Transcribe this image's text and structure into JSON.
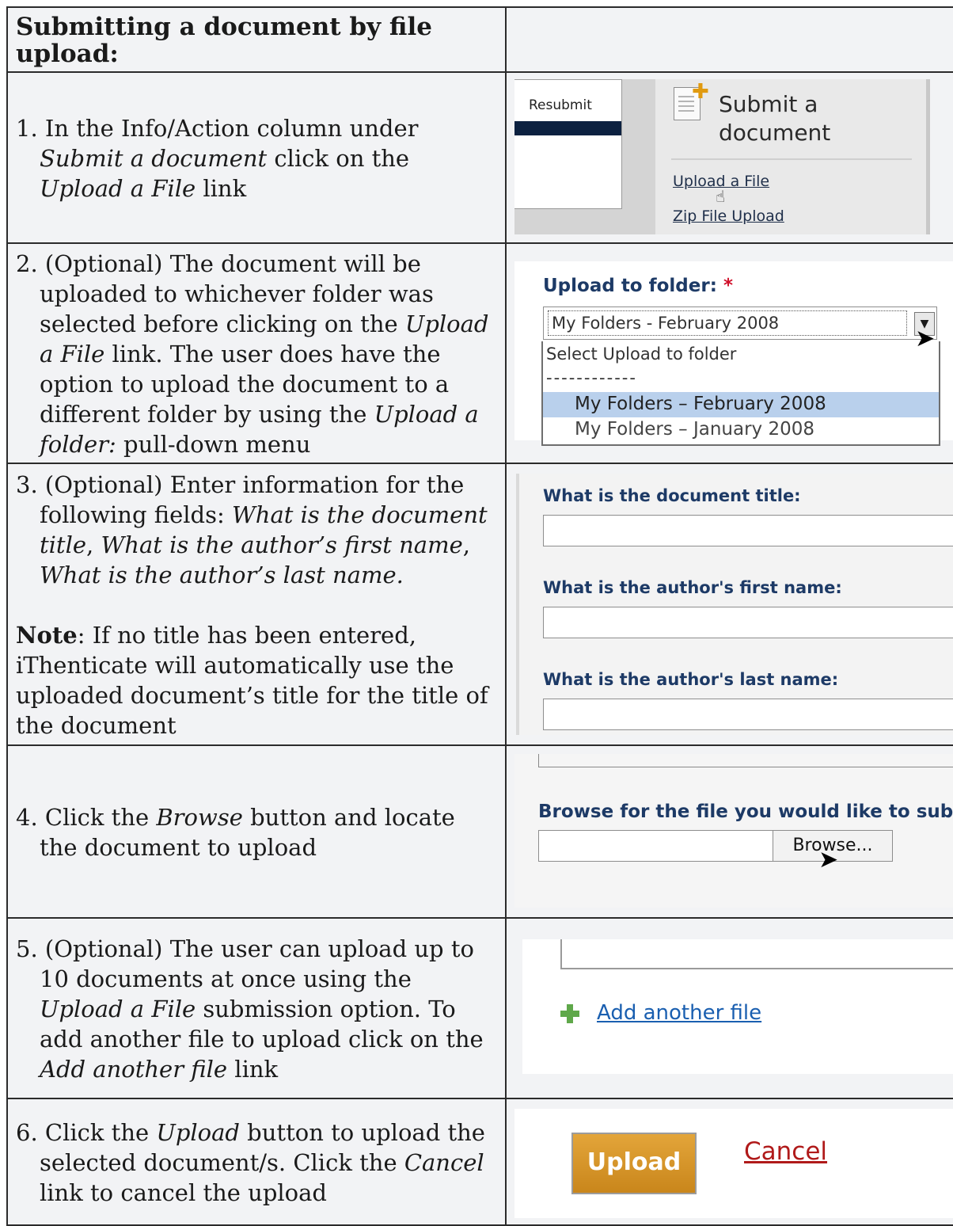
{
  "header": {
    "title": "Submitting a document by file upload:"
  },
  "steps": {
    "s1": {
      "num": "1.",
      "t1": "In the Info/Action column under ",
      "i1": "Submit a document",
      "t2": " click on the ",
      "i2": "Upload a File",
      "t3": " link"
    },
    "s2": {
      "num": "2.",
      "t1": "(Optional) The document will be uploaded to whichever folder was selected before clicking on the ",
      "i1": "Upload a File",
      "t2": " link.  The user does have the option to upload the document to a different folder by using the ",
      "i2": "Upload a folder:",
      "t3": " pull-down menu"
    },
    "s3": {
      "num": "3.",
      "t1": "(Optional) Enter information for the following fields: ",
      "i1": "What is the document title",
      "t2": ", ",
      "i2": "What is the author’s first name",
      "t3": ", ",
      "i3": "What is the author’s last name.",
      "note_label": "Note",
      "note_text": ": If no title has been entered, iThenticate will automatically use the uploaded document’s title for the title of the document"
    },
    "s4": {
      "num": "4.",
      "t1": "Click the ",
      "i1": "Browse",
      "t2": " button and locate the document to upload"
    },
    "s5": {
      "num": "5.",
      "t1": "(Optional) The user can upload up to 10 documents at once using the ",
      "i1": "Upload a File",
      "t2": " submission option. To add another file to upload click on the ",
      "i2": "Add another file",
      "t3": " link"
    },
    "s6": {
      "num": "6.",
      "t1": "Click the ",
      "i1": "Upload",
      "t2": " button to upload the selected document/s. Click the ",
      "i2": "Cancel",
      "t3": " link to cancel the upload"
    }
  },
  "shots": {
    "s1": {
      "tab_label": "Resubmit",
      "panel_title_1": "Submit a",
      "panel_title_2": "document",
      "link_upload": "Upload a File",
      "link_zip": "Zip File Upload",
      "icon": "document-add-icon"
    },
    "s2": {
      "label": "Upload to folder:",
      "required_mark": "*",
      "selected": "My Folders - February 2008",
      "options": [
        "Select Upload to folder",
        "------------",
        "My Folders – February 2008",
        "My Folders – January 2008"
      ]
    },
    "s3": {
      "labels": [
        "What is the document title:",
        "What is the author's first name:",
        "What is the author's last name:"
      ]
    },
    "s4": {
      "label": "Browse for the file you would like to subm",
      "button": "Browse..."
    },
    "s5": {
      "link": "Add another file",
      "icon": "plus-icon"
    },
    "s6": {
      "button": "Upload",
      "cancel": "Cancel"
    }
  },
  "colors": {
    "label_blue": "#1d3a66",
    "link_blue": "#1a5fb0",
    "upload_orange": "#d8961f",
    "cancel_red": "#b01a1a",
    "required_red": "#d0102a"
  }
}
